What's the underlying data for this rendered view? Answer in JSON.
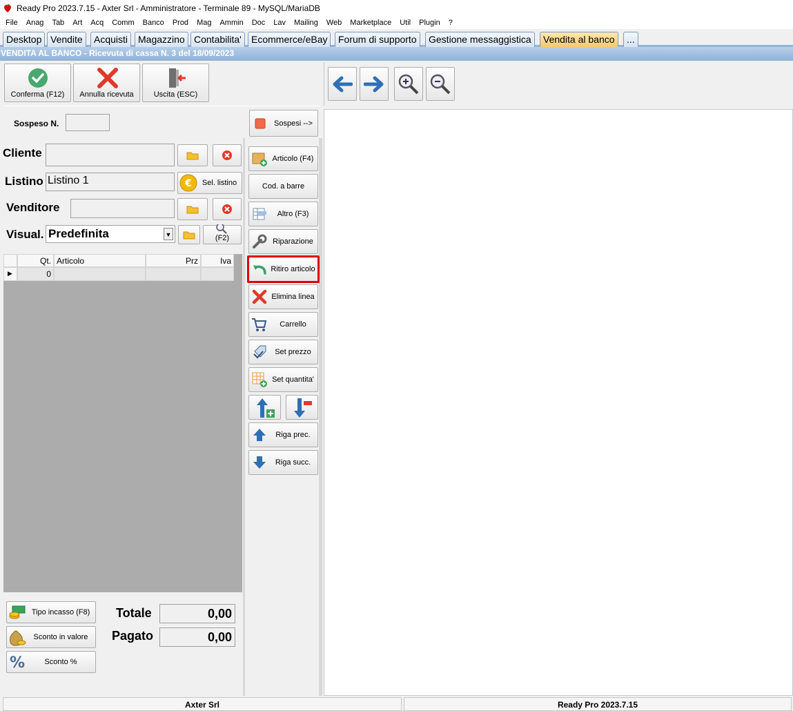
{
  "window": {
    "title": "Ready Pro 2023.7.15 - Axter Srl - Amministratore - Terminale 89 - MySQL/MariaDB"
  },
  "menu": [
    "File",
    "Anag",
    "Tab",
    "Art",
    "Acq",
    "Comm",
    "Banco",
    "Prod",
    "Mag",
    "Ammin",
    "Doc",
    "Lav",
    "Mailing",
    "Web",
    "Marketplace",
    "Util",
    "Plugin",
    "?"
  ],
  "tabs": [
    "Desktop",
    "Vendite",
    "Acquisti",
    "Magazzino",
    "Contabilita'",
    "Ecommerce/eBay",
    "Forum di supporto",
    "Gestione messaggistica",
    "Vendita al banco",
    "..."
  ],
  "subtitle": "VENDITA AL BANCO - Ricevuta di cassa N. 3 del 18/09/2023",
  "toolbar": {
    "confirm": "Conferma (F12)",
    "cancel": "Annulla ricevuta",
    "exit": "Uscita (ESC)"
  },
  "sospeso": {
    "label": "Sospeso N.",
    "value": "",
    "button": "Sospesi -->"
  },
  "form": {
    "cliente_label": "Cliente",
    "cliente_value": "",
    "listino_label": "Listino",
    "listino_value": "Listino 1",
    "sel_listino": "Sel. listino",
    "venditore_label": "Venditore",
    "venditore_value": "",
    "visual_label": "Visual.",
    "visual_value": "Predefinita",
    "f2_label": "(F2)"
  },
  "grid": {
    "columns": [
      "Qt.",
      "Articolo",
      "Prz",
      "Iva"
    ],
    "rows": [
      {
        "qt": "0",
        "articolo": "",
        "prz": "",
        "iva": ""
      }
    ]
  },
  "actions": {
    "articolo": "Articolo (F4)",
    "barcode": "Cod. a barre",
    "altro": "Altro (F3)",
    "riparazione": "Riparazione",
    "ritiro": "Ritiro articolo",
    "elimina": "Elimina linea",
    "carrello": "Carrello",
    "set_prezzo": "Set prezzo",
    "set_quantita": "Set quantita'",
    "riga_prec": "Riga prec.",
    "riga_succ": "Riga succ."
  },
  "payments": {
    "tipo_incasso": "Tipo incasso (F8)",
    "sconto_valore": "Sconto in valore",
    "sconto_pct": "Sconto %"
  },
  "totals": {
    "totale_label": "Totale",
    "totale_value": "0,00",
    "pagato_label": "Pagato",
    "pagato_value": "0,00"
  },
  "status": {
    "left": "Axter Srl",
    "right": "Ready Pro 2023.7.15"
  },
  "colors": {
    "highlight": "#e00000",
    "active_tab": "#f7c96a",
    "subtitle_bar": "#8fb2d8",
    "arrow_blue": "#2f6fb5"
  }
}
